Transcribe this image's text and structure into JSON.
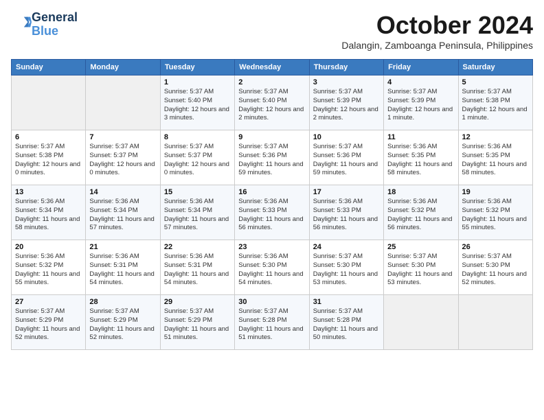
{
  "header": {
    "logo_line1": "General",
    "logo_line2": "Blue",
    "month": "October 2024",
    "location": "Dalangin, Zamboanga Peninsula, Philippines"
  },
  "weekdays": [
    "Sunday",
    "Monday",
    "Tuesday",
    "Wednesday",
    "Thursday",
    "Friday",
    "Saturday"
  ],
  "weeks": [
    [
      {
        "day": "",
        "info": ""
      },
      {
        "day": "",
        "info": ""
      },
      {
        "day": "1",
        "info": "Sunrise: 5:37 AM\nSunset: 5:40 PM\nDaylight: 12 hours and 3 minutes."
      },
      {
        "day": "2",
        "info": "Sunrise: 5:37 AM\nSunset: 5:40 PM\nDaylight: 12 hours and 2 minutes."
      },
      {
        "day": "3",
        "info": "Sunrise: 5:37 AM\nSunset: 5:39 PM\nDaylight: 12 hours and 2 minutes."
      },
      {
        "day": "4",
        "info": "Sunrise: 5:37 AM\nSunset: 5:39 PM\nDaylight: 12 hours and 1 minute."
      },
      {
        "day": "5",
        "info": "Sunrise: 5:37 AM\nSunset: 5:38 PM\nDaylight: 12 hours and 1 minute."
      }
    ],
    [
      {
        "day": "6",
        "info": "Sunrise: 5:37 AM\nSunset: 5:38 PM\nDaylight: 12 hours and 0 minutes."
      },
      {
        "day": "7",
        "info": "Sunrise: 5:37 AM\nSunset: 5:37 PM\nDaylight: 12 hours and 0 minutes."
      },
      {
        "day": "8",
        "info": "Sunrise: 5:37 AM\nSunset: 5:37 PM\nDaylight: 12 hours and 0 minutes."
      },
      {
        "day": "9",
        "info": "Sunrise: 5:37 AM\nSunset: 5:36 PM\nDaylight: 11 hours and 59 minutes."
      },
      {
        "day": "10",
        "info": "Sunrise: 5:37 AM\nSunset: 5:36 PM\nDaylight: 11 hours and 59 minutes."
      },
      {
        "day": "11",
        "info": "Sunrise: 5:36 AM\nSunset: 5:35 PM\nDaylight: 11 hours and 58 minutes."
      },
      {
        "day": "12",
        "info": "Sunrise: 5:36 AM\nSunset: 5:35 PM\nDaylight: 11 hours and 58 minutes."
      }
    ],
    [
      {
        "day": "13",
        "info": "Sunrise: 5:36 AM\nSunset: 5:34 PM\nDaylight: 11 hours and 58 minutes."
      },
      {
        "day": "14",
        "info": "Sunrise: 5:36 AM\nSunset: 5:34 PM\nDaylight: 11 hours and 57 minutes."
      },
      {
        "day": "15",
        "info": "Sunrise: 5:36 AM\nSunset: 5:34 PM\nDaylight: 11 hours and 57 minutes."
      },
      {
        "day": "16",
        "info": "Sunrise: 5:36 AM\nSunset: 5:33 PM\nDaylight: 11 hours and 56 minutes."
      },
      {
        "day": "17",
        "info": "Sunrise: 5:36 AM\nSunset: 5:33 PM\nDaylight: 11 hours and 56 minutes."
      },
      {
        "day": "18",
        "info": "Sunrise: 5:36 AM\nSunset: 5:32 PM\nDaylight: 11 hours and 56 minutes."
      },
      {
        "day": "19",
        "info": "Sunrise: 5:36 AM\nSunset: 5:32 PM\nDaylight: 11 hours and 55 minutes."
      }
    ],
    [
      {
        "day": "20",
        "info": "Sunrise: 5:36 AM\nSunset: 5:32 PM\nDaylight: 11 hours and 55 minutes."
      },
      {
        "day": "21",
        "info": "Sunrise: 5:36 AM\nSunset: 5:31 PM\nDaylight: 11 hours and 54 minutes."
      },
      {
        "day": "22",
        "info": "Sunrise: 5:36 AM\nSunset: 5:31 PM\nDaylight: 11 hours and 54 minutes."
      },
      {
        "day": "23",
        "info": "Sunrise: 5:36 AM\nSunset: 5:30 PM\nDaylight: 11 hours and 54 minutes."
      },
      {
        "day": "24",
        "info": "Sunrise: 5:37 AM\nSunset: 5:30 PM\nDaylight: 11 hours and 53 minutes."
      },
      {
        "day": "25",
        "info": "Sunrise: 5:37 AM\nSunset: 5:30 PM\nDaylight: 11 hours and 53 minutes."
      },
      {
        "day": "26",
        "info": "Sunrise: 5:37 AM\nSunset: 5:30 PM\nDaylight: 11 hours and 52 minutes."
      }
    ],
    [
      {
        "day": "27",
        "info": "Sunrise: 5:37 AM\nSunset: 5:29 PM\nDaylight: 11 hours and 52 minutes."
      },
      {
        "day": "28",
        "info": "Sunrise: 5:37 AM\nSunset: 5:29 PM\nDaylight: 11 hours and 52 minutes."
      },
      {
        "day": "29",
        "info": "Sunrise: 5:37 AM\nSunset: 5:29 PM\nDaylight: 11 hours and 51 minutes."
      },
      {
        "day": "30",
        "info": "Sunrise: 5:37 AM\nSunset: 5:28 PM\nDaylight: 11 hours and 51 minutes."
      },
      {
        "day": "31",
        "info": "Sunrise: 5:37 AM\nSunset: 5:28 PM\nDaylight: 11 hours and 50 minutes."
      },
      {
        "day": "",
        "info": ""
      },
      {
        "day": "",
        "info": ""
      }
    ]
  ]
}
